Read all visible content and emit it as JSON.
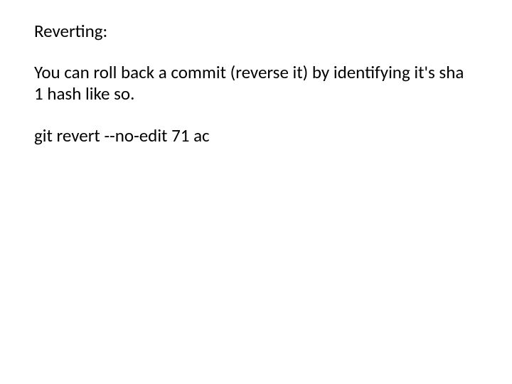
{
  "slide": {
    "heading": "Reverting:",
    "body": "You can roll back a commit (reverse it) by identifying it's sha 1 hash like so.",
    "command": "git revert --no-edit 71 ac"
  }
}
